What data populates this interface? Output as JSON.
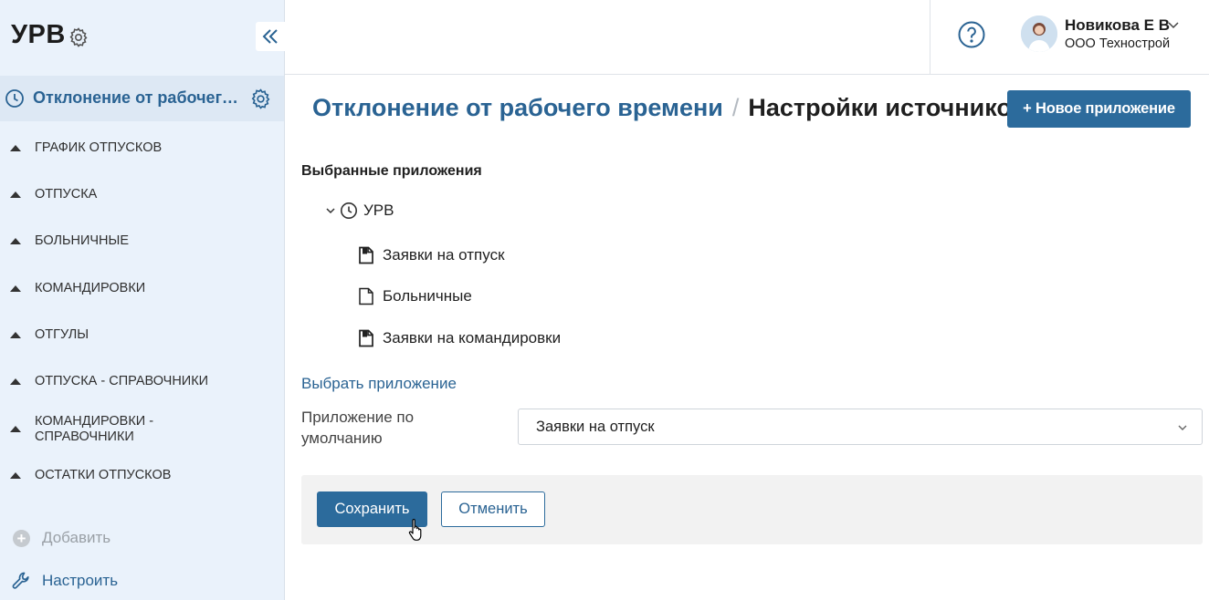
{
  "sidebar": {
    "app_title": "УРВ",
    "active_item": "Отклонение от рабочего времени",
    "items": [
      {
        "label": "ГРАФИК ОТПУСКОВ"
      },
      {
        "label": "ОТПУСКА"
      },
      {
        "label": "БОЛЬНИЧНЫЕ"
      },
      {
        "label": "КОМАНДИРОВКИ"
      },
      {
        "label": "ОТГУЛЫ"
      },
      {
        "label": "ОТПУСКА - СПРАВОЧНИКИ"
      },
      {
        "label": "КОМАНДИРОВКИ - СПРАВОЧНИКИ"
      },
      {
        "label": "ОСТАТКИ ОТПУСКОВ"
      }
    ],
    "add_label": "Добавить",
    "configure_label": "Настроить"
  },
  "header": {
    "user_name": "Новикова Е В",
    "user_org": "ООО Технострой"
  },
  "main": {
    "breadcrumb_parent": "Отклонение от рабочего времени",
    "breadcrumb_separator": "/",
    "breadcrumb_current": "Настройки источников",
    "new_app_button": "+ Новое приложение",
    "selected_title": "Выбранные приложения",
    "tree_root": "УРВ",
    "tree_children": [
      {
        "label": "Заявки на отпуск",
        "icon": "document-filled-icon"
      },
      {
        "label": "Больничные",
        "icon": "document-outline-icon"
      },
      {
        "label": "Заявки на командировки",
        "icon": "document-filled-icon"
      }
    ],
    "choose_app_link": "Выбрать приложение",
    "default_app_label": "Приложение по умолчанию",
    "default_app_value": "Заявки на отпуск",
    "save_button": "Сохранить",
    "cancel_button": "Отменить"
  },
  "colors": {
    "accent": "#2c6b9c",
    "link": "#2a6393",
    "sidebar_bg": "#eaf2fb"
  }
}
